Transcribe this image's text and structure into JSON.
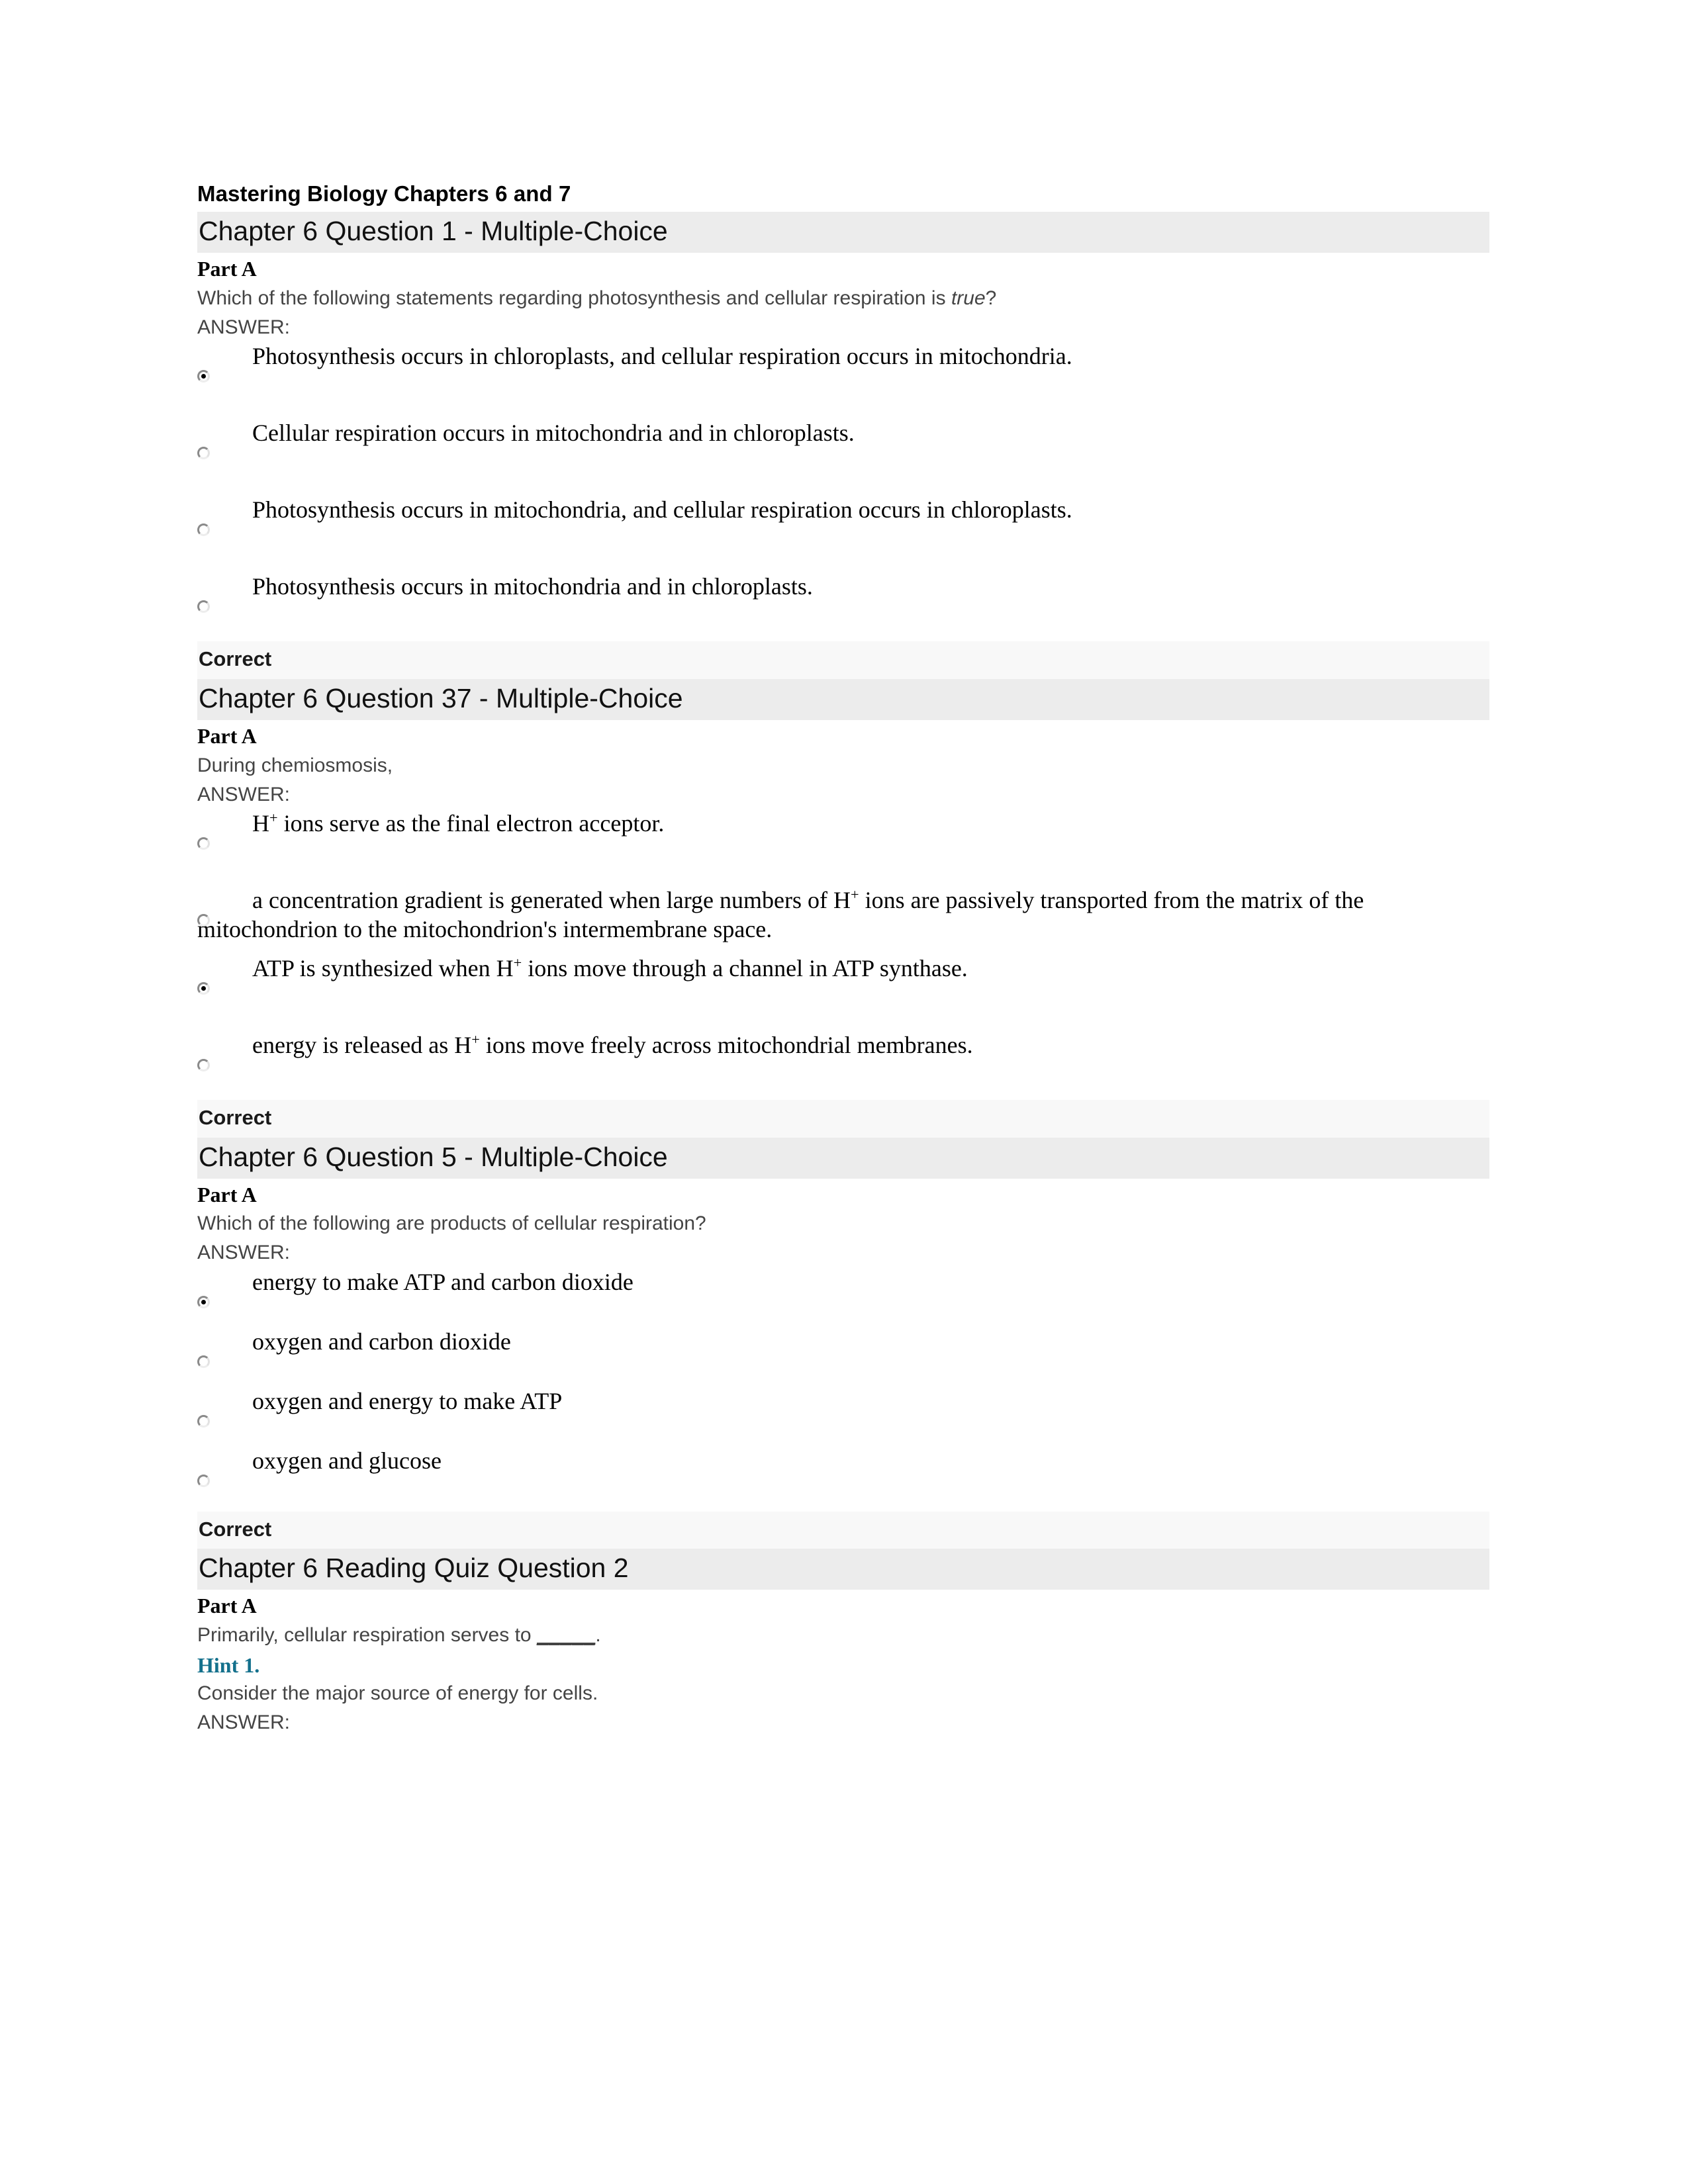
{
  "document": {
    "title": "Mastering Biology Chapters 6 and 7"
  },
  "labels": {
    "part_a": "Part A",
    "answer": "ANSWER:",
    "correct": "Correct"
  },
  "questions": [
    {
      "header": "Chapter 6 Question 1 - Multiple-Choice",
      "part": "Part A",
      "prompt_before": "Which of the following statements regarding photosynthesis and cellular respiration is ",
      "prompt_italic": "true",
      "prompt_after": "?",
      "answer_label": "ANSWER:",
      "options": [
        {
          "text": "Photosynthesis occurs in chloroplasts, and cellular respiration occurs in mitochondria.",
          "selected": true
        },
        {
          "text": "Cellular respiration occurs in mitochondria and in chloroplasts.",
          "selected": false
        },
        {
          "text": "Photosynthesis occurs in mitochondria, and cellular respiration occurs in chloroplasts.",
          "selected": false
        },
        {
          "text": "Photosynthesis occurs in mitochondria and in chloroplasts.",
          "selected": false
        }
      ],
      "status": "Correct"
    },
    {
      "header": "Chapter 6 Question 37 - Multiple-Choice",
      "part": "Part A",
      "prompt": "During chemiosmosis,",
      "answer_label": "ANSWER:",
      "options": [
        {
          "text_pre": "H",
          "sup": "+",
          "text_post": " ions serve as the final electron acceptor.",
          "selected": false
        },
        {
          "text_pre": "a concentration gradient is generated when large numbers of H",
          "sup": "+",
          "text_post": " ions are passively transported from the matrix of the mitochondrion to the mitochondrion's intermembrane space.",
          "selected": false
        },
        {
          "text_pre": "ATP is synthesized when H",
          "sup": "+",
          "text_post": " ions move through a channel in ATP synthase.",
          "selected": true
        },
        {
          "text_pre": "energy is released as H",
          "sup": "+",
          "text_post": " ions move freely across mitochondrial membranes.",
          "selected": false
        }
      ],
      "status": "Correct"
    },
    {
      "header": "Chapter 6 Question 5 - Multiple-Choice",
      "part": "Part A",
      "prompt": "Which of the following are products of cellular respiration?",
      "answer_label": "ANSWER:",
      "options": [
        {
          "text": "energy to make ATP and carbon dioxide",
          "selected": true
        },
        {
          "text": "oxygen and carbon dioxide",
          "selected": false
        },
        {
          "text": "oxygen and energy to make ATP",
          "selected": false
        },
        {
          "text": "oxygen and glucose",
          "selected": false
        }
      ],
      "status": "Correct"
    },
    {
      "header": "Chapter 6 Reading Quiz Question 2",
      "part": "Part A",
      "prompt_before": "Primarily, cellular respiration serves to ",
      "prompt_blank": "_____",
      "prompt_after": ".",
      "hint_label": "Hint 1.",
      "hint_text": "Consider the major source of energy for cells.",
      "answer_label": "ANSWER:"
    }
  ],
  "colors": {
    "header_bar": "#ececec",
    "status_bar": "#f8f8f8",
    "hint_link": "#13708c",
    "body_text": "#444444"
  }
}
